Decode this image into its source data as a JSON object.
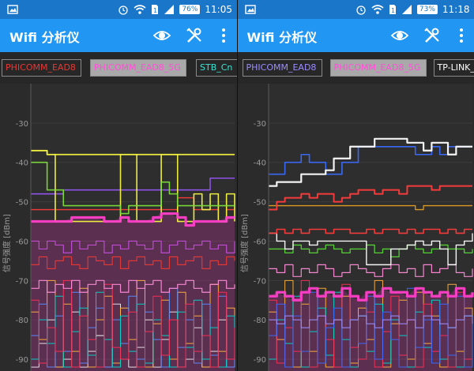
{
  "panels": [
    {
      "status": {
        "battery": "76%",
        "time": "11:05"
      },
      "toolbar": {
        "title": "Wifi 分析仪"
      },
      "tabs": [
        {
          "label": "PHICOMM_EAD8",
          "color": "#e53935",
          "selected": false
        },
        {
          "label": "PHICOMM_EAD8_5G",
          "color": "#ff4fd8",
          "selected": true
        },
        {
          "label": "STB_Cn",
          "color": "#40e0d0",
          "selected": false
        }
      ],
      "chart_data": {
        "type": "line",
        "ylabel": "信号强度 [dBm]",
        "yticks": [
          "-30",
          "-40",
          "-50",
          "-60",
          "-70",
          "-80",
          "-90"
        ],
        "ylim": [
          -93,
          -20
        ],
        "x": [
          0,
          1,
          2,
          3,
          4,
          5,
          6,
          7,
          8,
          9,
          10,
          11,
          12,
          13,
          14,
          15,
          16,
          17,
          18,
          19,
          20,
          21,
          22,
          23,
          24,
          25
        ],
        "series": [
          {
            "color": "#f5f542",
            "width": 1.8,
            "values": [
              -37,
              -37,
              -38,
              -38,
              -38,
              -38,
              -38,
              -38,
              -38,
              -38,
              -38,
              -38,
              -38,
              -38,
              -38,
              -38,
              -38,
              -38,
              -38,
              -38,
              -38,
              -38,
              -38,
              -38,
              -38,
              -38
            ]
          },
          {
            "color": "#f5f542",
            "width": 1.6,
            "values": [
              -37,
              -37,
              -38,
              -55,
              -55,
              -55,
              -55,
              -55,
              -55,
              -55,
              -55,
              -38,
              -38,
              -55,
              -55,
              -55,
              -38,
              -38,
              -55,
              -55,
              -48,
              -52,
              -48,
              -55,
              -48,
              -55
            ]
          },
          {
            "color": "#7ddf3a",
            "width": 1.6,
            "values": [
              -40,
              -40,
              -47,
              -47,
              -51,
              -51,
              -51,
              -51,
              -51,
              -51,
              -51,
              -53,
              -51,
              -51,
              -51,
              -51,
              -45,
              -48,
              -51,
              -51,
              -51,
              -51,
              -51,
              -51,
              -51,
              -51
            ]
          },
          {
            "color": "#9a58ff",
            "width": 1.4,
            "values": [
              -48,
              -48,
              -48,
              -48,
              -47,
              -47,
              -47,
              -47,
              -47,
              -47,
              -47,
              -47,
              -47,
              -47,
              -47,
              -47,
              -47,
              -47,
              -47,
              -47,
              -47,
              -47,
              -44,
              -44,
              -44,
              -44
            ]
          },
          {
            "color": "#ff3b3b",
            "width": 1.4,
            "values": [
              -52,
              -52,
              -52,
              -52,
              -52,
              -52,
              -52,
              -52,
              -52,
              -52,
              -52,
              -52,
              -52,
              -52,
              -52,
              -52,
              -52,
              -52,
              -49,
              -49,
              -52,
              -52,
              -52,
              -55,
              -52,
              -52
            ]
          },
          {
            "color": "#ff3ec9",
            "width": 3.2,
            "values": [
              -55,
              -55,
              -55,
              -55,
              -55,
              -54,
              -54,
              -54,
              -54,
              -55,
              -55,
              -54,
              -55,
              -55,
              -55,
              -54,
              -53,
              -53,
              -54,
              -56,
              -55,
              -55,
              -55,
              -55,
              -54,
              -54
            ]
          },
          {
            "color": "#c14ed9",
            "width": 1.2,
            "values": [
              -60,
              -62,
              -60,
              -61,
              -63,
              -60,
              -62,
              -61,
              -60,
              -63,
              -61,
              -62,
              -60,
              -61,
              -62,
              -60,
              -63,
              -61,
              -60,
              -62,
              -61,
              -60,
              -62,
              -61,
              -63,
              -60
            ]
          },
          {
            "color": "#e53935",
            "width": 1.2,
            "values": [
              -66,
              -64,
              -67,
              -65,
              -64,
              -66,
              -67,
              -64,
              -65,
              -66,
              -64,
              -67,
              -65,
              -64,
              -66,
              -65,
              -67,
              -64,
              -66,
              -65,
              -64,
              -67,
              -65,
              -66,
              -64,
              -65
            ]
          },
          {
            "color": "#ff8cd9",
            "width": 1.2,
            "values": [
              -72,
              -70,
              -73,
              -71,
              -72,
              -70,
              -73,
              -71,
              -70,
              -72,
              -71,
              -73,
              -70,
              -72,
              -71,
              -70,
              -73,
              -72,
              -71,
              -70,
              -72,
              -73,
              -71,
              -70,
              -72,
              -71
            ]
          },
          {
            "color": "#ffb13b",
            "width": 1.0,
            "values": [
              -78,
              -85,
              -70,
              -92,
              -76,
              -88,
              -72,
              -92,
              -80,
              -74,
              -91,
              -77,
              -85,
              -70,
              -92,
              -81,
              -75,
              -90,
              -73,
              -86,
              -79,
              -92,
              -71,
              -88,
              -77,
              -84
            ]
          },
          {
            "color": "#5a8cff",
            "width": 1.0,
            "values": [
              -84,
              -76,
              -92,
              -79,
              -88,
              -73,
              -91,
              -82,
              -77,
              -92,
              -80,
              -86,
              -74,
              -90,
              -78,
              -85,
              -92,
              -72,
              -87,
              -80,
              -91,
              -76,
              -89,
              -74,
              -92,
              -81
            ]
          },
          {
            "color": "#00d6c8",
            "width": 1.0,
            "values": [
              -90,
              -80,
              -86,
              -74,
              -92,
              -83,
              -77,
              -89,
              -73,
              -85,
              -92,
              -79,
              -88,
              -76,
              -91,
              -80,
              -84,
              -92,
              -78,
              -87,
              -75,
              -90,
              -82,
              -92,
              -79,
              -86
            ]
          },
          {
            "color": "#ff2d55",
            "width": 1.0,
            "values": [
              -75,
              -91,
              -82,
              -88,
              -70,
              -92,
              -79,
              -85,
              -92,
              -71,
              -87,
              -90,
              -78,
              -92,
              -83,
              -74,
              -89,
              -80,
              -92,
              -76,
              -88,
              -84,
              -92,
              -73,
              -90,
              -82
            ]
          },
          {
            "color": "#ffffff",
            "width": 0.9,
            "values": [
              -92,
              -86,
              -80,
              -92,
              -90,
              -78,
              -92,
              -88,
              -84,
              -92,
              -76,
              -90,
              -92,
              -87,
              -80,
              -92,
              -85,
              -78,
              -92,
              -90,
              -82,
              -92,
              -88,
              -80,
              -92,
              -86
            ]
          }
        ]
      }
    },
    {
      "status": {
        "battery": "73%",
        "time": "11:18"
      },
      "toolbar": {
        "title": "Wifi 分析仪"
      },
      "tabs": [
        {
          "label": "PHICOMM_EAD8",
          "color": "#9b8cff",
          "selected": false
        },
        {
          "label": "PHICOMM_EAD8_5G",
          "color": "#ff4fd8",
          "selected": true
        },
        {
          "label": "TP-LINK_",
          "color": "#ffffff",
          "selected": false
        }
      ],
      "chart_data": {
        "type": "line",
        "ylabel": "信号强度 [dBm]",
        "yticks": [
          "-30",
          "-40",
          "-50",
          "-60",
          "-70",
          "-80",
          "-90"
        ],
        "ylim": [
          -93,
          -20
        ],
        "x": [
          0,
          1,
          2,
          3,
          4,
          5,
          6,
          7,
          8,
          9,
          10,
          11,
          12,
          13,
          14,
          15,
          16,
          17,
          18,
          19,
          20,
          21,
          22,
          23,
          24,
          25
        ],
        "series": [
          {
            "color": "#ffffff",
            "width": 2.2,
            "values": [
              -46,
              -45,
              -45,
              -45,
              -43,
              -43,
              -43,
              -42,
              -39,
              -39,
              -36,
              -36,
              -36,
              -34,
              -34,
              -34,
              -34,
              -35,
              -35,
              -37,
              -35,
              -35,
              -38,
              -36,
              -36,
              -36
            ]
          },
          {
            "color": "#ffffff",
            "width": 1.4,
            "values": [
              -58,
              -60,
              -62,
              -60,
              -60,
              -61,
              -60,
              -60,
              -60,
              -60,
              -60,
              -60,
              -66,
              -66,
              -66,
              -62,
              -62,
              -61,
              -60,
              -61,
              -60,
              -62,
              -66,
              -61,
              -60,
              -58
            ]
          },
          {
            "color": "#3a6cff",
            "width": 1.6,
            "values": [
              -43,
              -43,
              -40,
              -40,
              -38,
              -40,
              -40,
              -43,
              -43,
              -40,
              -40,
              -36,
              -36,
              -36,
              -36,
              -36,
              -36,
              -36,
              -38,
              -38,
              -36,
              -38,
              -36,
              -36,
              -36,
              -36
            ]
          },
          {
            "color": "#ff3b3b",
            "width": 2.0,
            "values": [
              -52,
              -50,
              -49,
              -49,
              -48,
              -49,
              -48,
              -48,
              -50,
              -49,
              -48,
              -47,
              -47,
              -48,
              -47,
              -47,
              -48,
              -46,
              -46,
              -46,
              -47,
              -46,
              -46,
              -46,
              -46,
              -46
            ]
          },
          {
            "color": "#e6a020",
            "width": 1.3,
            "values": [
              -51,
              -51,
              -51,
              -51,
              -51,
              -51,
              -51,
              -51,
              -51,
              -51,
              -51,
              -51,
              -51,
              -51,
              -51,
              -51,
              -51,
              -51,
              -52,
              -51,
              -51,
              -51,
              -51,
              -51,
              -51,
              -51
            ]
          },
          {
            "color": "#ff3b3b",
            "width": 1.6,
            "values": [
              -58,
              -57,
              -58,
              -57,
              -58,
              -57,
              -57,
              -58,
              -57,
              -57,
              -58,
              -58,
              -57,
              -58,
              -57,
              -57,
              -58,
              -57,
              -58,
              -57,
              -57,
              -58,
              -57,
              -58,
              -57,
              -57
            ]
          },
          {
            "color": "#57d636",
            "width": 1.3,
            "values": [
              -62,
              -62,
              -63,
              -61,
              -62,
              -63,
              -62,
              -61,
              -62,
              -63,
              -62,
              -62,
              -61,
              -63,
              -62,
              -64,
              -62,
              -61,
              -62,
              -63,
              -62,
              -61,
              -62,
              -62,
              -63,
              -62
            ]
          },
          {
            "color": "#ff3ec9",
            "width": 3.2,
            "values": [
              -74,
              -73,
              -74,
              -75,
              -73,
              -72,
              -74,
              -73,
              -74,
              -72,
              -74,
              -75,
              -73,
              -74,
              -72,
              -73,
              -73,
              -74,
              -72,
              -73,
              -74,
              -73,
              -74,
              -72,
              -74,
              -73
            ]
          },
          {
            "color": "#ff8cd9",
            "width": 1.2,
            "values": [
              -67,
              -68,
              -66,
              -69,
              -67,
              -68,
              -66,
              -67,
              -69,
              -68,
              -66,
              -67,
              -68,
              -69,
              -67,
              -66,
              -68,
              -67,
              -69,
              -66,
              -68,
              -67,
              -66,
              -68,
              -69,
              -67
            ]
          },
          {
            "color": "#9b8cff",
            "width": 1.1,
            "values": [
              -80,
              -81,
              -79,
              -80,
              -82,
              -80,
              -79,
              -81,
              -80,
              -82,
              -80,
              -79,
              -81,
              -82,
              -80,
              -79,
              -81,
              -80,
              -82,
              -79,
              -80,
              -81,
              -82,
              -80,
              -79,
              -81
            ]
          },
          {
            "color": "#ffb13b",
            "width": 1.0,
            "values": [
              -78,
              -85,
              -70,
              -92,
              -76,
              -88,
              -72,
              -92,
              -80,
              -74,
              -91,
              -77,
              -85,
              -70,
              -92,
              -81,
              -75,
              -90,
              -73,
              -86,
              -79,
              -92,
              -71,
              -88,
              -77,
              -84
            ]
          },
          {
            "color": "#00d6c8",
            "width": 1.0,
            "values": [
              -90,
              -80,
              -86,
              -74,
              -92,
              -83,
              -77,
              -89,
              -73,
              -85,
              -92,
              -79,
              -88,
              -76,
              -91,
              -80,
              -84,
              -92,
              -78,
              -87,
              -75,
              -90,
              -82,
              -92,
              -79,
              -86
            ]
          },
          {
            "color": "#ff2d55",
            "width": 1.0,
            "values": [
              -75,
              -91,
              -82,
              -88,
              -70,
              -92,
              -79,
              -85,
              -92,
              -71,
              -87,
              -90,
              -78,
              -92,
              -83,
              -74,
              -89,
              -80,
              -92,
              -76,
              -88,
              -84,
              -92,
              -73,
              -90,
              -82
            ]
          },
          {
            "color": "#3a6cff",
            "width": 1.0,
            "values": [
              -84,
              -76,
              -92,
              -79,
              -88,
              -73,
              -91,
              -82,
              -77,
              -92,
              -80,
              -86,
              -74,
              -90,
              -78,
              -85,
              -92,
              -72,
              -87,
              -80,
              -91,
              -76,
              -89,
              -74,
              -92,
              -81
            ]
          }
        ]
      }
    }
  ]
}
